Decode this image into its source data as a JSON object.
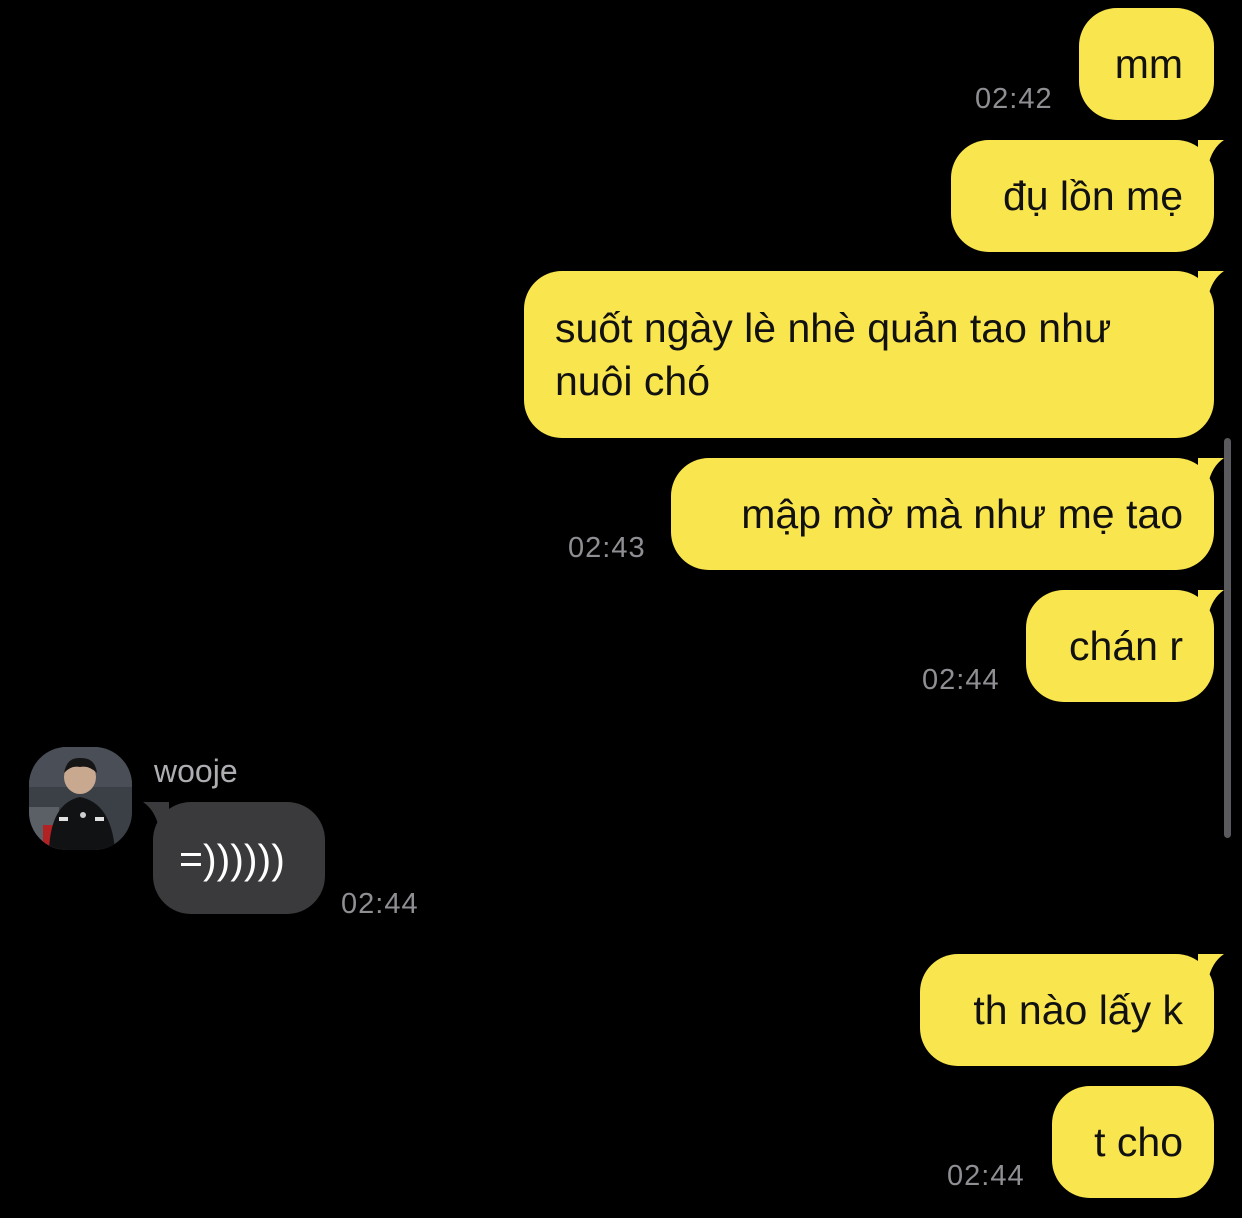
{
  "chat": {
    "messages": [
      {
        "from": "me",
        "text": "mm",
        "time": "02:42"
      },
      {
        "from": "me",
        "text": "đụ lồn mẹ",
        "time": ""
      },
      {
        "from": "me",
        "lines": [
          "suốt ngày lè nhè quản tao như",
          "nuôi chó"
        ],
        "time": ""
      },
      {
        "from": "me",
        "text": "mập mờ mà như mẹ tao",
        "time": "02:43"
      },
      {
        "from": "me",
        "text": "chán r",
        "time": "02:44"
      },
      {
        "from": "them",
        "sender": "wooje",
        "avatar_icon": "profile-photo-avatar",
        "text": "=))))))",
        "time": "02:44"
      },
      {
        "from": "me",
        "text": "th nào lấy k",
        "time": ""
      },
      {
        "from": "me",
        "text": "t cho",
        "time": "02:44"
      }
    ]
  },
  "colors": {
    "background": "#000000",
    "my_bubble": "#f9e54e",
    "their_bubble": "#3a3a3c",
    "timestamp": "#8e8e93"
  }
}
